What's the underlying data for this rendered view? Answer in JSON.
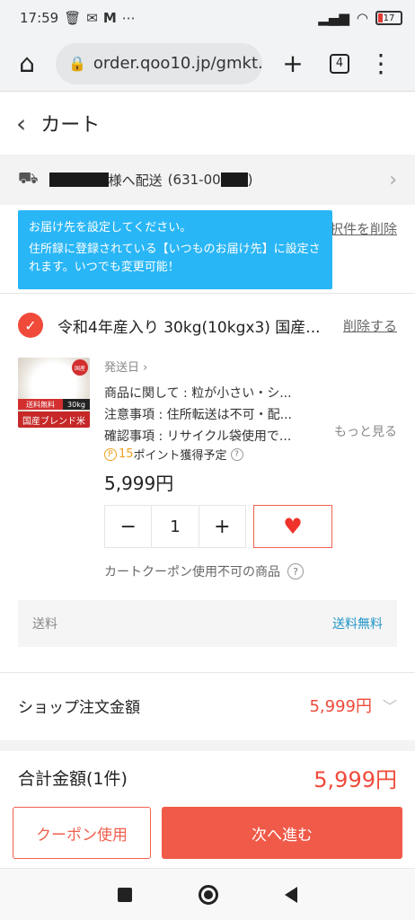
{
  "status_bar": {
    "time": "17:59",
    "icons_left": [
      "trash-icon",
      "mail-icon",
      "mcdonalds-icon",
      "more-icon"
    ],
    "battery": "17"
  },
  "browser": {
    "url": "order.qoo10.jp/gmkt.i",
    "tab_count": "4"
  },
  "header": {
    "title": "カート"
  },
  "delivery": {
    "suffix": "様へ配送",
    "postal_prefix": "(631-00",
    "postal_suffix": ")"
  },
  "delete_selected_label": "択件を削除",
  "tooltip": {
    "line1": "お届け先を設定してください。",
    "line2": "住所録に登録されている【いつものお届け先】に設定されます。いつでも変更可能！"
  },
  "item": {
    "title": "令和4年産入り 30kg(10kgx3) 国産...",
    "delete_label": "削除する",
    "thumb": {
      "badge": "国産",
      "band1": "送料無料",
      "band1_right": "30kg",
      "band2": "国産ブレンド米"
    },
    "ship_date_label": "発送日",
    "desc_lines": [
      "商品に関して : 粒が小さい・シ...",
      "注意事項 : 住所転送は不可・配...",
      "確認事項 : リサイクル袋使用で..."
    ],
    "more_label": "もっと見る",
    "points_num": "15",
    "points_text": "ポイント獲得予定",
    "price": "5,999円",
    "quantity": "1",
    "coupon_note": "カートクーポン使用不可の商品"
  },
  "shipping": {
    "label": "送料",
    "value": "送料無料"
  },
  "shop_total": {
    "label": "ショップ注文金額",
    "amount": "5,999円"
  },
  "grand_total": {
    "label": "合計金額(1件)",
    "amount": "5,999円"
  },
  "buttons": {
    "coupon": "クーポン使用",
    "next": "次へ進む"
  },
  "colors": {
    "accent": "#f05a48",
    "tooltip": "#29b6f6",
    "link_blue": "#2196c8",
    "points": "#f0a020"
  }
}
